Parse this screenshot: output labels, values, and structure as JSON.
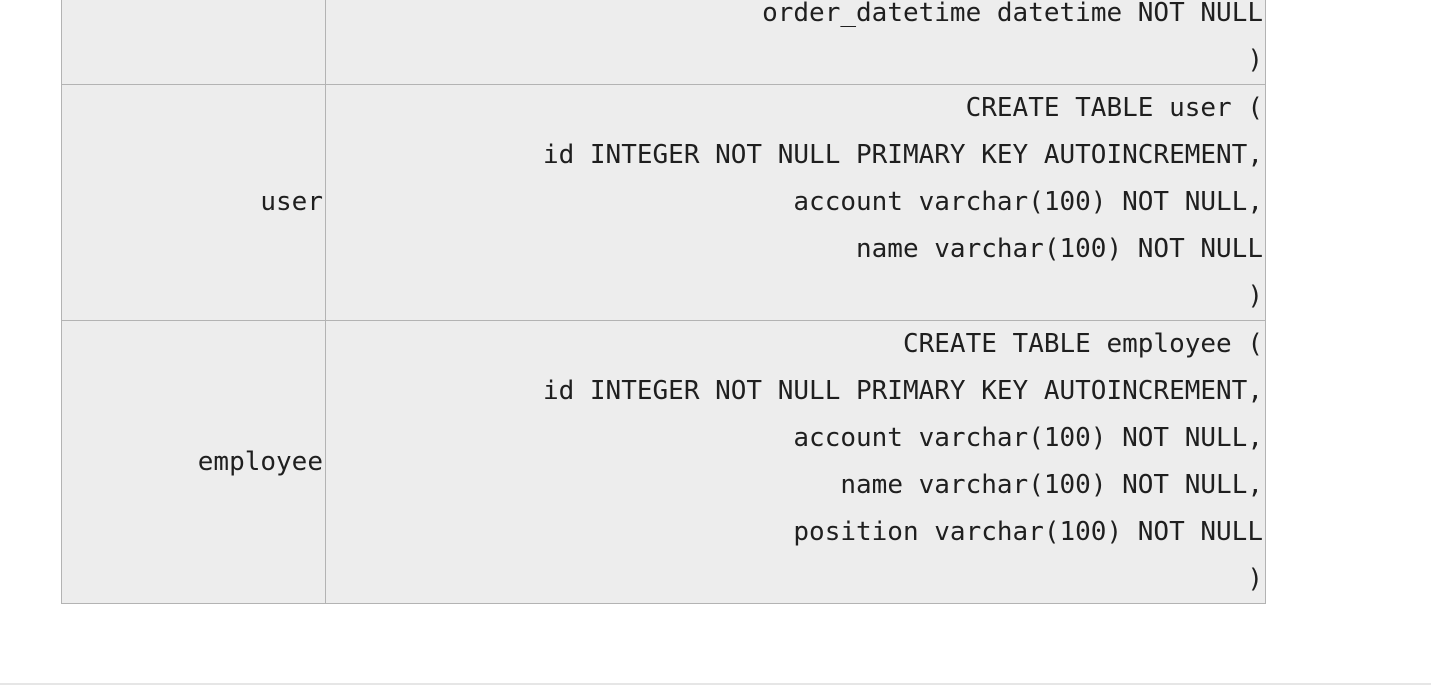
{
  "rows": [
    {
      "name": "",
      "sql": [
        "order_datetime datetime NOT NULL",
        ")"
      ]
    },
    {
      "name": "user",
      "sql": [
        "CREATE TABLE user (",
        "id INTEGER NOT NULL PRIMARY KEY AUTOINCREMENT,",
        "account varchar(100) NOT NULL,",
        "name varchar(100) NOT NULL",
        ")"
      ]
    },
    {
      "name": "employee",
      "sql": [
        "CREATE TABLE employee (",
        "id INTEGER NOT NULL PRIMARY KEY AUTOINCREMENT,",
        "account varchar(100) NOT NULL,",
        "name varchar(100) NOT NULL,",
        "position varchar(100) NOT NULL",
        ")"
      ]
    }
  ]
}
